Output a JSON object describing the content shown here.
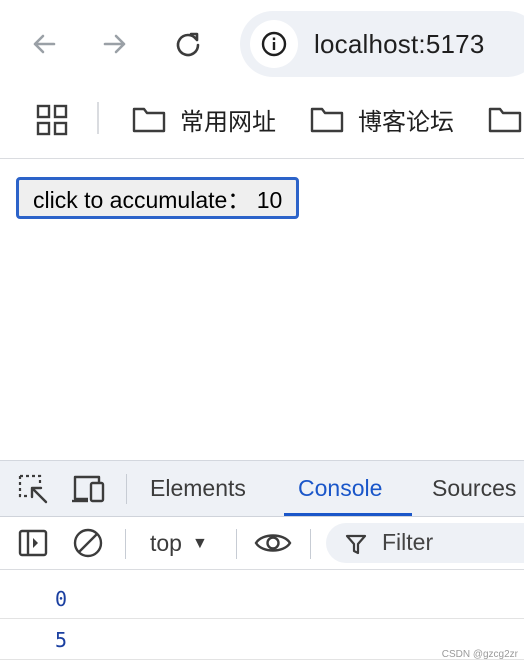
{
  "browser": {
    "url": "localhost:5173",
    "bookmarks": [
      {
        "label": "常用网址"
      },
      {
        "label": "博客论坛"
      },
      {
        "label": ""
      }
    ]
  },
  "page": {
    "button_label": "click to accumulate：  10"
  },
  "devtools": {
    "tabs": [
      "Elements",
      "Console",
      "Sources"
    ],
    "active_tab": "Console",
    "context": "top",
    "filter_placeholder": "Filter",
    "logs": [
      "0",
      "5"
    ]
  },
  "watermark": "CSDN @gzcg2zr",
  "colors": {
    "accent": "#1a56c9",
    "button_border": "#2c63c9",
    "log_number": "#1a3fa0"
  }
}
